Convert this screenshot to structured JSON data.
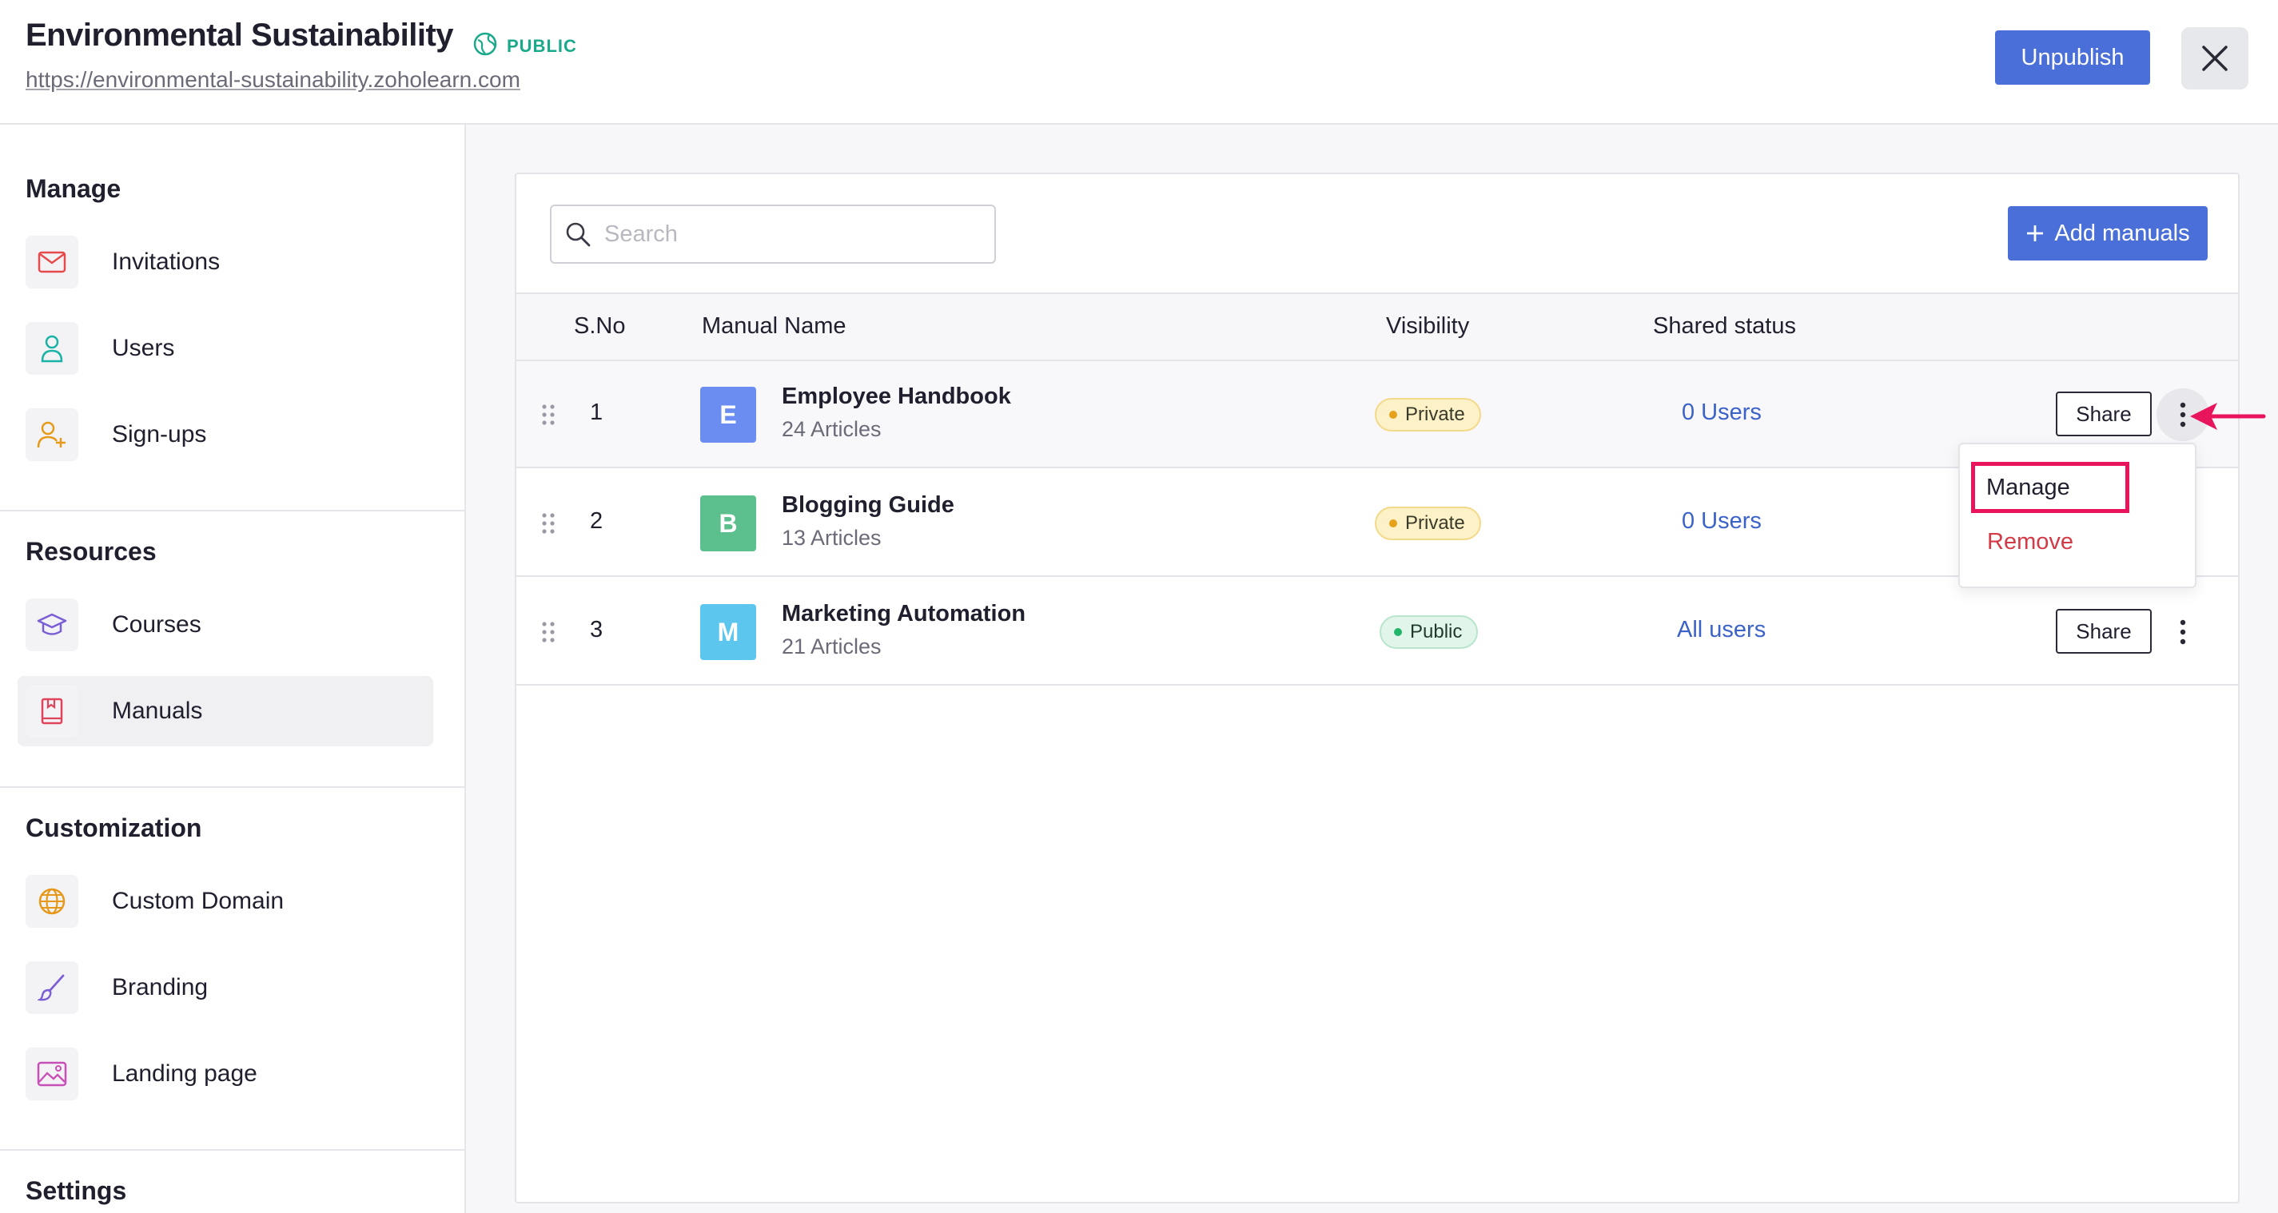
{
  "header": {
    "title": "Environmental Sustainability",
    "status": "PUBLIC",
    "url": "https://environmental-sustainability.zoholearn.com",
    "unpublish_label": "Unpublish"
  },
  "sidebar": {
    "sections": [
      {
        "title": "Manage",
        "items": [
          {
            "label": "Invitations",
            "icon": "mail-icon"
          },
          {
            "label": "Users",
            "icon": "user-icon"
          },
          {
            "label": "Sign-ups",
            "icon": "user-add-icon"
          }
        ]
      },
      {
        "title": "Resources",
        "items": [
          {
            "label": "Courses",
            "icon": "graduation-cap-icon"
          },
          {
            "label": "Manuals",
            "icon": "book-icon",
            "active": true
          }
        ]
      },
      {
        "title": "Customization",
        "items": [
          {
            "label": "Custom Domain",
            "icon": "globe-icon"
          },
          {
            "label": "Branding",
            "icon": "brush-icon"
          },
          {
            "label": "Landing page",
            "icon": "image-icon"
          }
        ]
      },
      {
        "title": "Settings",
        "items": []
      }
    ]
  },
  "main": {
    "search_placeholder": "Search",
    "add_label": "Add manuals",
    "columns": [
      "S.No",
      "Manual Name",
      "Visibility",
      "Shared status"
    ],
    "rows": [
      {
        "sno": "1",
        "initial": "E",
        "name": "Employee Handbook",
        "articles": "24 Articles",
        "visibility": "Private",
        "shared": "0 Users",
        "share_label": "Share",
        "avatar_color": "#6b8cf0"
      },
      {
        "sno": "2",
        "initial": "B",
        "name": "Blogging Guide",
        "articles": "13 Articles",
        "visibility": "Private",
        "shared": "0 Users",
        "share_label": "Share",
        "avatar_color": "#5bbf8e"
      },
      {
        "sno": "3",
        "initial": "M",
        "name": "Marketing Automation",
        "articles": "21 Articles",
        "visibility": "Public",
        "shared": "All users",
        "share_label": "Share",
        "avatar_color": "#5cc6ee"
      }
    ],
    "menu": {
      "manage": "Manage",
      "remove": "Remove"
    }
  },
  "colors": {
    "accent": "#4a6fd8",
    "highlight": "#e8155d",
    "public": "#1aa98a"
  }
}
